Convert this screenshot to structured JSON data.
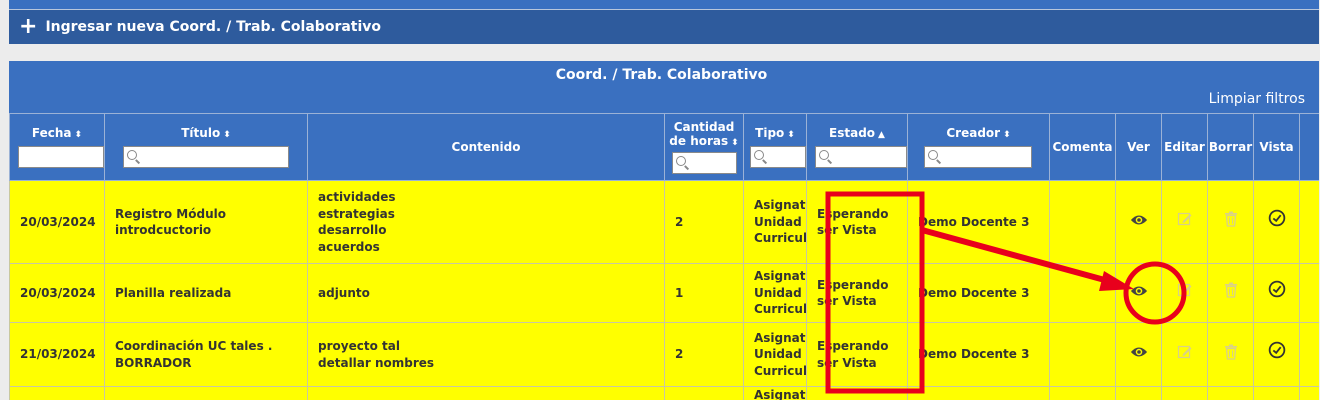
{
  "new_entry": {
    "icon": "plus-icon",
    "label": "Ingresar nueva Coord. / Trab. Colaborativo"
  },
  "panel": {
    "title": "Coord. / Trab. Colaborativo",
    "clear_filters": "Limpiar filtros"
  },
  "columns": {
    "fecha": "Fecha",
    "titulo": "Título",
    "contenido": "Contenido",
    "horas_1": "Cantidad",
    "horas_2": "de horas",
    "tipo": "Tipo",
    "estado": "Estado",
    "creador": "Creador",
    "comentarios": "Comenta",
    "ver": "Ver",
    "editar": "Editar",
    "borrar": "Borrar",
    "vista": "Vista"
  },
  "rows": [
    {
      "fecha": "20/03/2024",
      "titulo": [
        "Registro Módulo",
        "introdcuctorio"
      ],
      "contenido": [
        "actividades",
        "estrategias",
        "desarrollo",
        "acuerdos"
      ],
      "horas": "2",
      "tipo": [
        "Asignatura",
        "Unidad",
        "Curricular"
      ],
      "estado": [
        "Esperando",
        "ser Vista"
      ],
      "creador": "Demo Docente 3"
    },
    {
      "fecha": "20/03/2024",
      "titulo": [
        "Planilla realizada"
      ],
      "contenido": [
        "adjunto"
      ],
      "horas": "1",
      "tipo": [
        "Asignatura",
        "Unidad",
        "Curricular"
      ],
      "estado": [
        "Esperando",
        "ser Vista"
      ],
      "creador": "Demo Docente 3"
    },
    {
      "fecha": "21/03/2024",
      "titulo": [
        "Coordinación UC tales .",
        "BORRADOR"
      ],
      "contenido": [
        "proyecto tal",
        "detallar nombres"
      ],
      "horas": "2",
      "tipo": [
        "Asignatura",
        "Unidad",
        "Curricular"
      ],
      "estado": [
        "Esperando",
        "ser Vista"
      ],
      "creador": "Demo Docente 3"
    },
    {
      "tipo": [
        "Asignatura"
      ]
    }
  ],
  "icons": {
    "view": "eye-icon",
    "edit": "pencil-icon",
    "delete": "trash-icon",
    "seen": "check-circle-icon",
    "search": "search-icon"
  },
  "colors": {
    "header_blue": "#3a70c0",
    "bar_blue": "#2e5b9d",
    "row_yellow": "#ffff00",
    "annotation_red": "#e8001c"
  }
}
